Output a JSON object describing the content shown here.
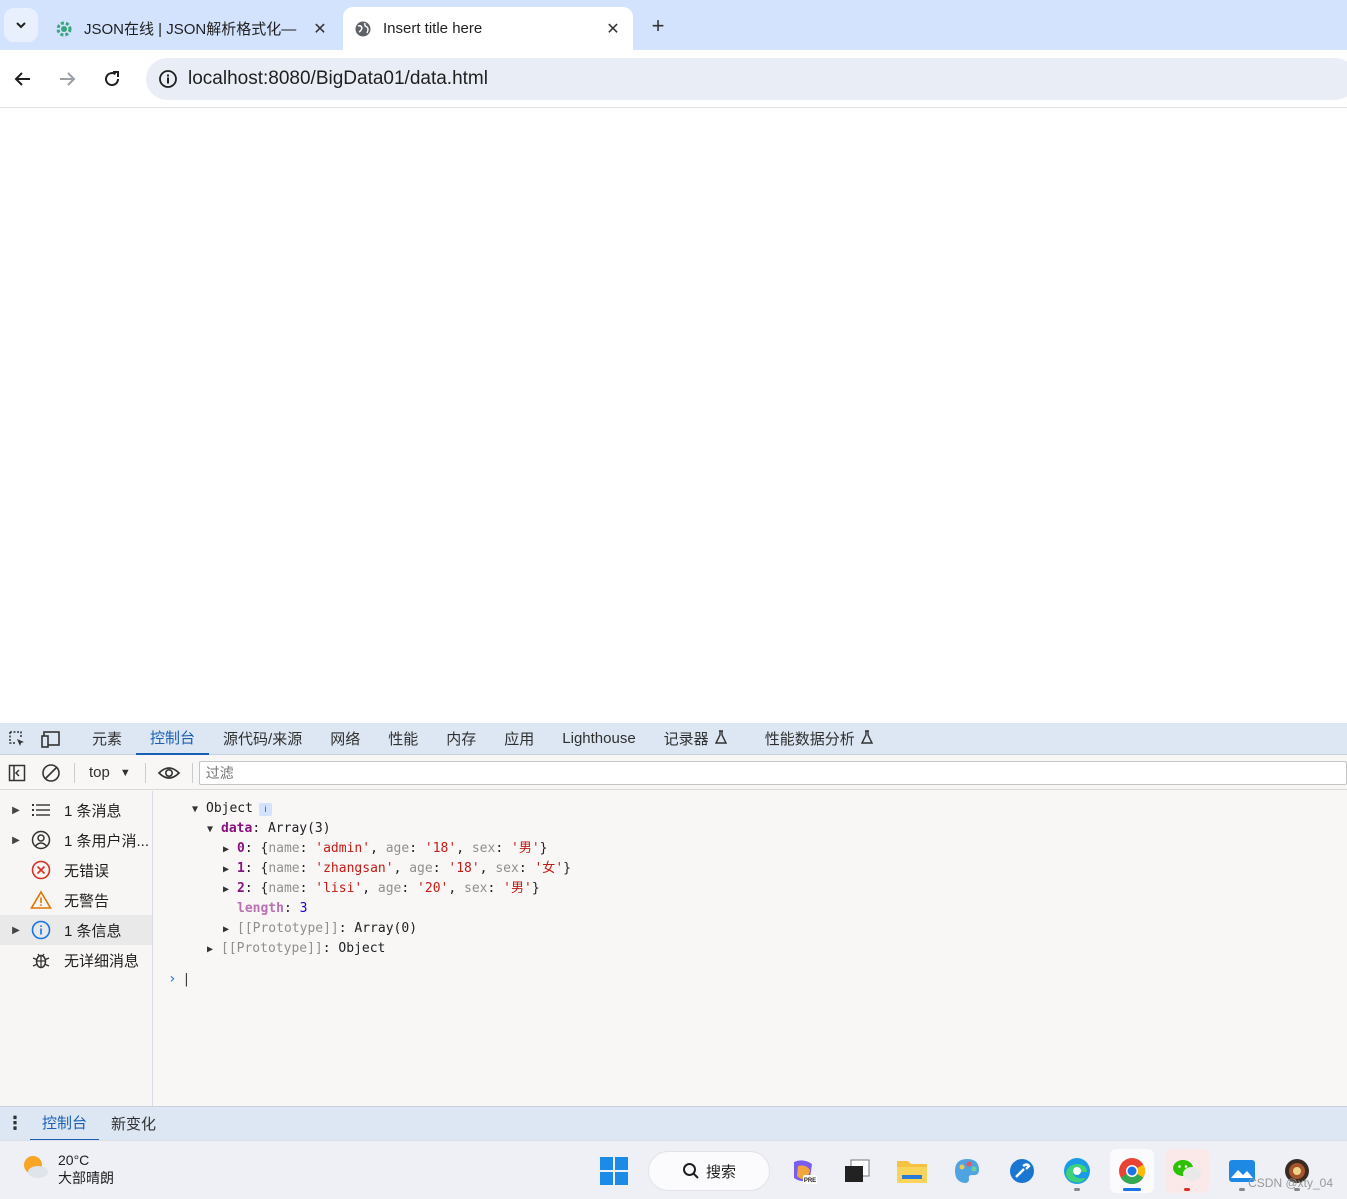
{
  "browser": {
    "tabs": [
      {
        "title": "JSON在线 | JSON解析格式化—",
        "active": false
      },
      {
        "title": "Insert title here",
        "active": true
      }
    ],
    "close_glyph": "✕",
    "new_tab_glyph": "+",
    "url": "localhost:8080/BigData01/data.html"
  },
  "devtools": {
    "tabs": [
      "元素",
      "控制台",
      "源代码/来源",
      "网络",
      "性能",
      "内存",
      "应用",
      "Lighthouse",
      "记录器",
      "性能数据分析"
    ],
    "active_tab": "控制台",
    "context": "top",
    "filter_placeholder": "过滤",
    "sidebar": [
      {
        "label": "1 条消息",
        "icon": "list-icon",
        "expandable": true
      },
      {
        "label": "1 条用户消...",
        "icon": "user-icon",
        "expandable": true
      },
      {
        "label": "无错误",
        "icon": "error-icon",
        "expandable": false
      },
      {
        "label": "无警告",
        "icon": "warning-icon",
        "expandable": false
      },
      {
        "label": "1 条信息",
        "icon": "info-icon",
        "expandable": true
      },
      {
        "label": "无详细消息",
        "icon": "bug-icon",
        "expandable": false
      }
    ],
    "console": {
      "root": "Object",
      "data_key": "data",
      "data_type": "Array(3)",
      "items": [
        {
          "index": "0",
          "name": "admin",
          "age": "18",
          "sex": "男"
        },
        {
          "index": "1",
          "name": "zhangsan",
          "age": "18",
          "sex": "女"
        },
        {
          "index": "2",
          "name": "lisi",
          "age": "20",
          "sex": "男"
        }
      ],
      "length_key": "length",
      "length_value": "3",
      "array_proto_key": "[[Prototype]]",
      "array_proto_value": "Array(0)",
      "object_proto_key": "[[Prototype]]",
      "object_proto_value": "Object"
    },
    "drawer_tabs": [
      "控制台",
      "新变化"
    ]
  },
  "taskbar": {
    "temperature": "20°C",
    "weather": "大部晴朗",
    "search_label": "搜索",
    "watermark": "CSDN @xty_04"
  },
  "colors": {
    "tabstrip": "#d3e3fd",
    "accent": "#1a5fb4",
    "string": "#c41a16",
    "number": "#1c00cf",
    "key": "#881280"
  }
}
